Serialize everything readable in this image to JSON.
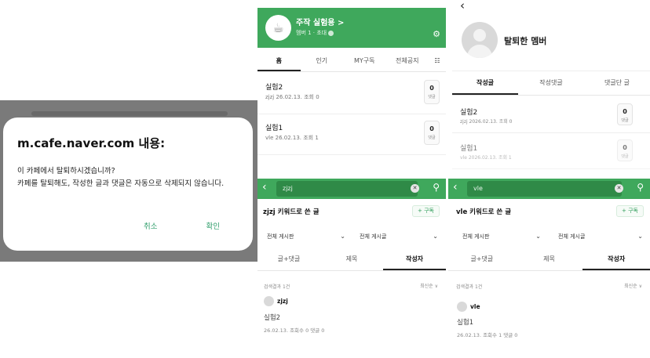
{
  "dialog": {
    "title": "m.cafe.naver.com 내용:",
    "message_line1": "이 카페에서 탈퇴하시겠습니까?",
    "message_line2": "카페를 탈퇴해도, 작성한 글과 댓글은 자동으로 삭제되지 않습니다.",
    "cancel_label": "취소",
    "confirm_label": "확인"
  },
  "cafe_home": {
    "cafe_name": "주작 실험용 >",
    "cafe_sub": "멤버 1 · 초대",
    "tabs": [
      "홈",
      "인기",
      "MY구독",
      "전체공지"
    ],
    "posts": [
      {
        "title": "실험2",
        "meta": "zjzj 26.02.13. 조회 0",
        "count": "0",
        "count_label": "댓글"
      },
      {
        "title": "실험1",
        "meta": "vle 26.02.13. 조회 1",
        "count": "0",
        "count_label": "댓글"
      }
    ]
  },
  "member": {
    "name": "탈퇴한 멤버",
    "tabs": [
      "작성글",
      "작성댓글",
      "댓글단 글"
    ],
    "posts": [
      {
        "title": "실험2",
        "meta": "zjzj 2026.02.13. 조회 0",
        "count": "0",
        "count_label": "댓글"
      },
      {
        "title": "실험1",
        "meta": "vle 2026.02.13. 조회 1",
        "count": "0",
        "count_label": "댓글"
      }
    ]
  },
  "search_a": {
    "query": "zjzj",
    "keyword_title": "zjzj 키워드로 쓴 글",
    "subscribe_label": "+ 구독",
    "filter_left": "전체 게시판",
    "filter_right": "전체 게시글",
    "tabs": [
      "글+댓글",
      "제목",
      "작성자"
    ],
    "result_count": "검색결과 1건",
    "sort_label": "최신순 ∨",
    "result": {
      "author": "zjzj",
      "title": "실험2",
      "meta": "26.02.13. 조회수 0 댓글 0"
    }
  },
  "search_b": {
    "query": "vle",
    "keyword_title": "vle 키워드로 쓴 글",
    "subscribe_label": "+ 구독",
    "filter_left": "전체 게시판",
    "filter_right": "전체 게시글",
    "tabs": [
      "글+댓글",
      "제목",
      "작성자"
    ],
    "result_count": "검색결과 1건",
    "sort_label": "최신순 ∨",
    "result": {
      "author": "vle",
      "title": "실험1",
      "meta": "26.02.13. 조회수 1 댓글 0"
    }
  },
  "colors": {
    "brand_green": "#3fa85c",
    "dialog_button": "#2e9d6a"
  },
  "icons": {
    "back": "chevron-left-icon",
    "search": "search-icon",
    "clear": "clear-icon",
    "settings": "gear-icon",
    "menu": "grid-icon"
  }
}
